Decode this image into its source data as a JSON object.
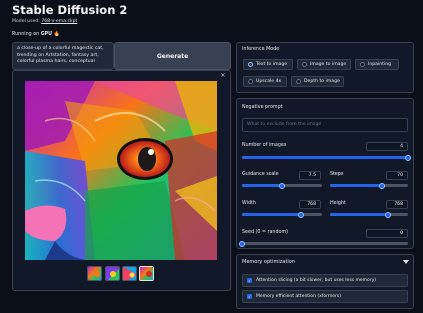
{
  "app": {
    "title": "Stable Diffusion 2",
    "model_prefix": "Model used: ",
    "model_link": "768-v-ema.ckpt",
    "running_prefix": "Running on ",
    "running_device": "GPU",
    "running_emoji": "🔥"
  },
  "prompt": {
    "text": "a close-up of a colorful magestic cat, trending on Artstation, fantasy art, colorful plasma hairs, conceptual"
  },
  "generate_label": "Generate",
  "gallery": {
    "close_label": "×",
    "thumbnail_count": 4,
    "selected_index": 3
  },
  "inference": {
    "label": "Inference Mode",
    "options": [
      "Text to image",
      "Image to image",
      "Inpainting",
      "Upscale 4x",
      "Depth to image"
    ],
    "selected": "Text to image"
  },
  "negative_prompt": {
    "label": "Negative prompt",
    "placeholder": "What to exclude from the image"
  },
  "sliders": {
    "num_images": {
      "label": "Number of images",
      "value": "4",
      "fraction": 1.0
    },
    "guidance": {
      "label": "Guidance scale",
      "value": "7.5",
      "fraction": 0.5
    },
    "steps": {
      "label": "Steps",
      "value": "70",
      "fraction": 0.67
    },
    "width": {
      "label": "Width",
      "value": "768",
      "fraction": 0.74
    },
    "height": {
      "label": "Height",
      "value": "768",
      "fraction": 0.74
    },
    "seed": {
      "label": "Seed (0 = random)",
      "value": "0",
      "fraction": 0.0
    }
  },
  "memory": {
    "title": "Memory optimization",
    "options": [
      {
        "label": "Attention slicing (a bit slower, but uses less memory)",
        "checked": true
      },
      {
        "label": "Memory efficient attention (xformers)",
        "checked": true
      }
    ]
  },
  "colors": {
    "accent": "#2563eb",
    "background": "#0b0f19",
    "panel": "#111827"
  }
}
